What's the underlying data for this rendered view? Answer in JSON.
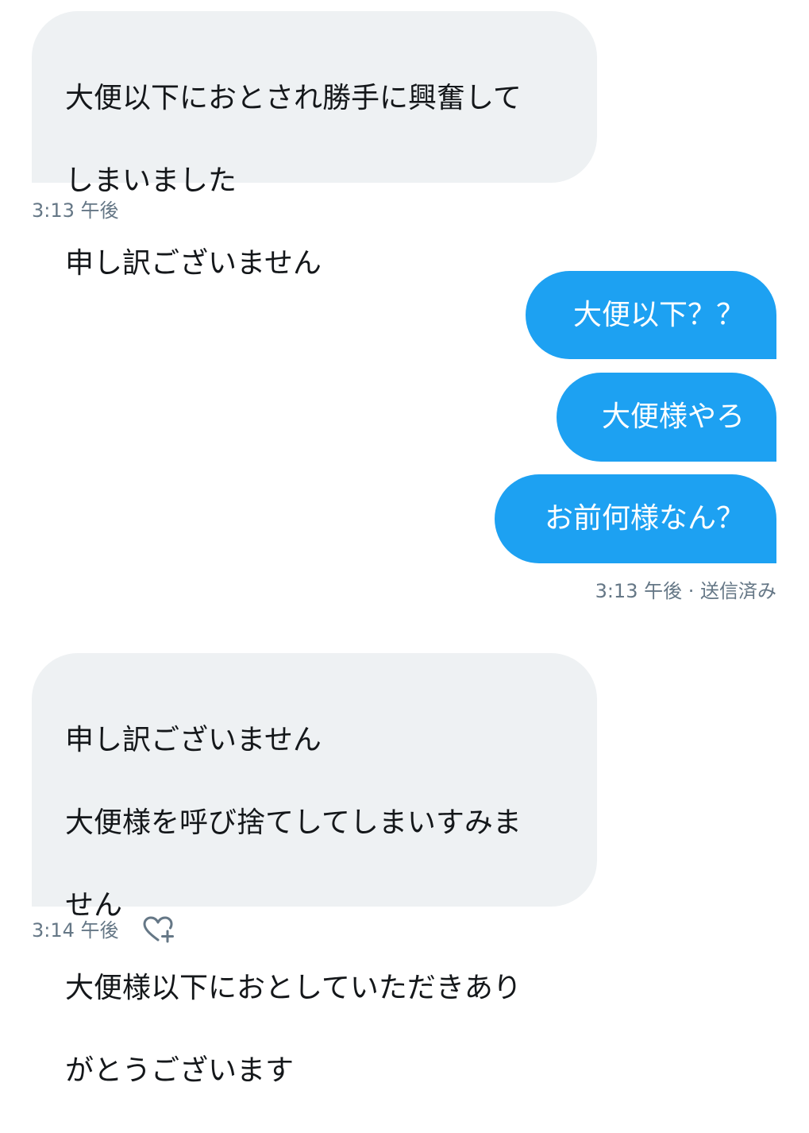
{
  "conversation": {
    "messages": [
      {
        "direction": "received",
        "lines": [
          "大便以下におとされ勝手に興奮して",
          "しまいました",
          "申し訳ございません"
        ],
        "time": "3:13 午後"
      },
      {
        "direction": "sent",
        "text": "大便以下？？"
      },
      {
        "direction": "sent",
        "text": "大便様やろ"
      },
      {
        "direction": "sent",
        "text": "お前何様なん？",
        "time": "3:13 午後 · 送信済み"
      },
      {
        "direction": "received",
        "lines": [
          "申し訳ございません",
          "大便様を呼び捨てしてしまいすみま",
          "せん",
          "大便様以下におとしていただきあり",
          "がとうございます"
        ],
        "time": "3:14 午後"
      }
    ]
  },
  "icons": {
    "react": "heart-plus-icon"
  },
  "colors": {
    "sent_bubble": "#1da1f2",
    "received_bubble": "#eef1f3",
    "meta_text": "#657786",
    "body_text": "#14171a"
  }
}
